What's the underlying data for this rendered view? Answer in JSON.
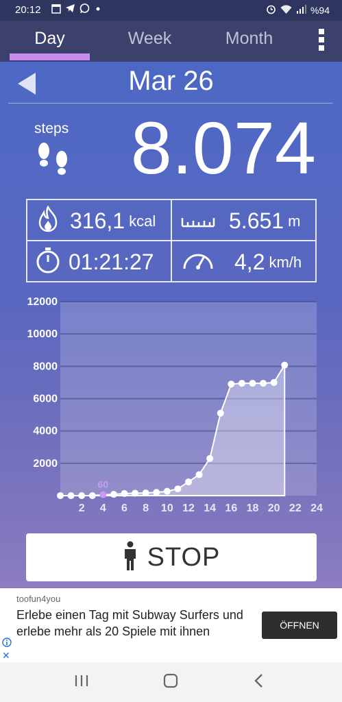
{
  "status_bar": {
    "time": "20:12",
    "battery": "%94",
    "notification_icons": [
      "calendar-icon",
      "telegram-icon",
      "whatsapp-icon",
      "dot-icon"
    ],
    "system_icons": [
      "alarm-icon",
      "wifi-icon",
      "signal-icon"
    ]
  },
  "tabs": [
    {
      "label": "Day",
      "active": true
    },
    {
      "label": "Week",
      "active": false
    },
    {
      "label": "Month",
      "active": false
    }
  ],
  "date": "Mar 26",
  "steps": {
    "label": "steps",
    "value": "8.074"
  },
  "stats": {
    "calories": {
      "value": "316,1",
      "unit": "kcal",
      "icon": "flame-icon"
    },
    "distance": {
      "value": "5.651",
      "unit": "m",
      "icon": "ruler-icon"
    },
    "duration": {
      "value": "01:21:27",
      "icon": "stopwatch-icon"
    },
    "speed": {
      "value": "4,2",
      "unit": "km/h",
      "icon": "speedometer-icon"
    }
  },
  "stop_button": {
    "label": "STOP",
    "icon": "person-icon"
  },
  "chart_data": {
    "type": "area",
    "x": [
      0,
      1,
      2,
      3,
      4,
      5,
      6,
      7,
      8,
      9,
      10,
      11,
      12,
      13,
      14,
      15,
      16,
      17,
      18,
      19,
      20,
      21
    ],
    "y": [
      0,
      0,
      0,
      0,
      60,
      80,
      130,
      150,
      170,
      200,
      270,
      420,
      850,
      1300,
      2300,
      5100,
      6900,
      6950,
      6950,
      6950,
      7000,
      8074
    ],
    "highlight": {
      "x": 4,
      "label": "60"
    },
    "xticks": [
      "2",
      "4",
      "6",
      "8",
      "10",
      "12",
      "14",
      "16",
      "18",
      "20",
      "22",
      "24"
    ],
    "yticks": [
      "2000",
      "4000",
      "6000",
      "8000",
      "10000",
      "12000"
    ],
    "xlim": [
      0,
      24
    ],
    "ylim": [
      0,
      12000
    ],
    "grid": true
  },
  "ad": {
    "brand": "toofun4you",
    "text": "Erlebe einen Tag mit Subway Surfers und erlebe mehr als 20 Spiele mit ihnen",
    "button": "ÖFFNEN"
  },
  "colors": {
    "accent": "#c78cf0",
    "highlight_point": "#c79cf7",
    "tab_bar": "#3b416b"
  }
}
